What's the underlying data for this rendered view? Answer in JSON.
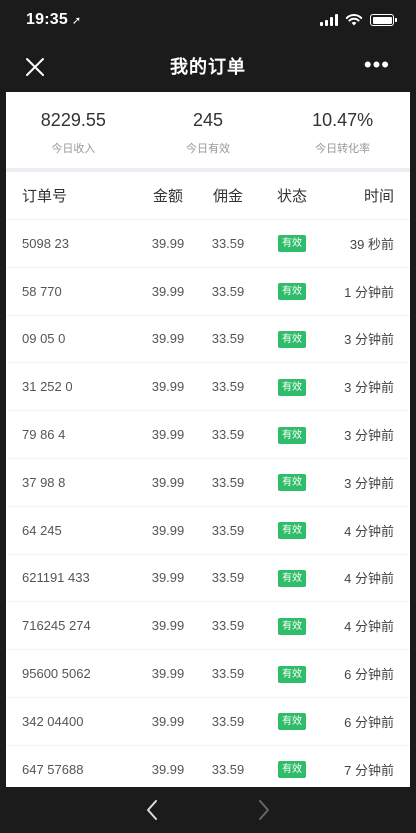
{
  "status_bar": {
    "time": "19:35",
    "location_glyph": "➚"
  },
  "nav": {
    "title": "我的订单",
    "close_glyph": "close-icon",
    "more_glyph": "•••"
  },
  "summary": [
    {
      "value": "8229.55",
      "label": "今日收入"
    },
    {
      "value": "245",
      "label": "今日有效"
    },
    {
      "value": "10.47%",
      "label": "今日转化率"
    }
  ],
  "table": {
    "headers": {
      "order": "订单号",
      "amount": "金额",
      "commission": "佣金",
      "status": "状态",
      "time": "时间"
    },
    "rows": [
      {
        "order": "5098 23",
        "amount": "39.99",
        "commission": "33.59",
        "status": "有效",
        "time": "39 秒前"
      },
      {
        "order": "58 770",
        "amount": "39.99",
        "commission": "33.59",
        "status": "有效",
        "time": "1 分钟前"
      },
      {
        "order": "09 05 0",
        "amount": "39.99",
        "commission": "33.59",
        "status": "有效",
        "time": "3 分钟前"
      },
      {
        "order": "31 252 0",
        "amount": "39.99",
        "commission": "33.59",
        "status": "有效",
        "time": "3 分钟前"
      },
      {
        "order": "79 86 4",
        "amount": "39.99",
        "commission": "33.59",
        "status": "有效",
        "time": "3 分钟前"
      },
      {
        "order": "37 98 8",
        "amount": "39.99",
        "commission": "33.59",
        "status": "有效",
        "time": "3 分钟前"
      },
      {
        "order": "64 245",
        "amount": "39.99",
        "commission": "33.59",
        "status": "有效",
        "time": "4 分钟前"
      },
      {
        "order": "621191 433",
        "amount": "39.99",
        "commission": "33.59",
        "status": "有效",
        "time": "4 分钟前"
      },
      {
        "order": "716245 274",
        "amount": "39.99",
        "commission": "33.59",
        "status": "有效",
        "time": "4 分钟前"
      },
      {
        "order": "95600 5062",
        "amount": "39.99",
        "commission": "33.59",
        "status": "有效",
        "time": "6 分钟前"
      },
      {
        "order": "342 04400",
        "amount": "39.99",
        "commission": "33.59",
        "status": "有效",
        "time": "6 分钟前"
      },
      {
        "order": "647 57688",
        "amount": "39.99",
        "commission": "33.59",
        "status": "有效",
        "time": "7 分钟前"
      }
    ]
  },
  "bottom_bar": {
    "back_icon": "chevron-left-icon",
    "forward_icon": "chevron-right-icon"
  },
  "colors": {
    "status_green": "#2fbd6a",
    "chrome": "#1b1b1b"
  }
}
